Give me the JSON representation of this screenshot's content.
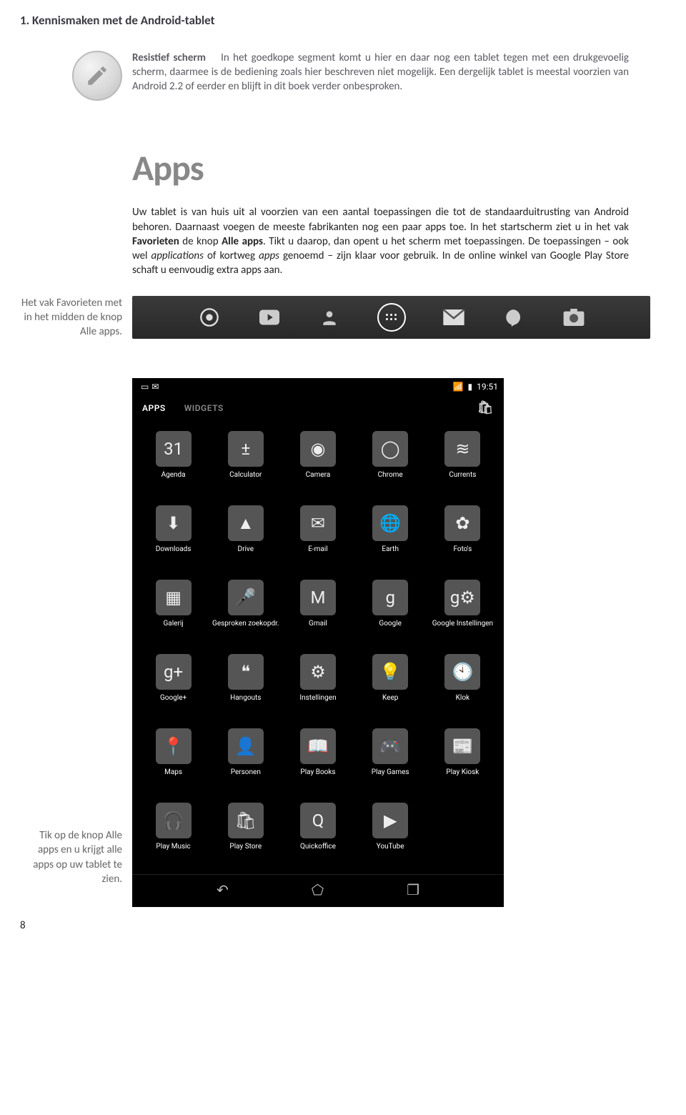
{
  "page": {
    "header": "1. Kennismaken met de Android-tablet",
    "number": "8"
  },
  "intro": {
    "lead": "Resistief scherm",
    "text": "In het goedkope segment komt u hier en daar nog een tablet tegen met een drukgevoelig scherm, daarmee is de bediening zoals hier beschreven niet mogelijk. Een dergelijk tablet is meestal voorzien van Android 2.2 of eerder en blijft in dit boek verder onbesproken."
  },
  "apps_section": {
    "title": "Apps",
    "body_prefix": "Uw tablet is van huis uit al voorzien van een aantal toepassingen die tot de standaarduitrusting van Android behoren. Daarnaast voegen de meeste fabrikanten nog een paar apps toe. In het startscherm ziet u in het vak ",
    "bold1": "Favorieten",
    "body_mid1": " de knop ",
    "bold2": "Alle apps",
    "body_mid2": ". Tikt u daarop, dan opent u het scherm met toepassingen. De toepassingen – ook wel ",
    "italic": "applications",
    "body_mid3": " of kortweg ",
    "italic2": "apps",
    "body_suffix": " genoemd – zijn klaar voor gebruik. In de online winkel van Google Play Store schaft u eenvoudig extra apps aan."
  },
  "caption1": "Het vak Favorieten met in het midden de knop Alle apps.",
  "caption2": "Tik op de knop Alle apps en u krijgt alle apps op uw tablet te zien.",
  "favbar": {
    "icons": [
      "chrome-icon",
      "youtube-icon",
      "people-icon",
      "allapps-icon",
      "gmail-icon",
      "hangouts-icon",
      "camera-icon"
    ]
  },
  "phone": {
    "time": "19:51",
    "tabs": {
      "apps": "APPS",
      "widgets": "WIDGETS"
    },
    "apps": [
      {
        "label": "Agenda",
        "icon": "calendar-icon",
        "glyph": "31"
      },
      {
        "label": "Calculator",
        "icon": "calculator-icon",
        "glyph": "±"
      },
      {
        "label": "Camera",
        "icon": "camera-icon",
        "glyph": "◉"
      },
      {
        "label": "Chrome",
        "icon": "chrome-icon",
        "glyph": "◯"
      },
      {
        "label": "Currents",
        "icon": "currents-icon",
        "glyph": "≋"
      },
      {
        "label": "Downloads",
        "icon": "downloads-icon",
        "glyph": "⬇"
      },
      {
        "label": "Drive",
        "icon": "drive-icon",
        "glyph": "▲"
      },
      {
        "label": "E-mail",
        "icon": "email-icon",
        "glyph": "✉"
      },
      {
        "label": "Earth",
        "icon": "earth-icon",
        "glyph": "🌐"
      },
      {
        "label": "Foto's",
        "icon": "photos-icon",
        "glyph": "✿"
      },
      {
        "label": "Galerij",
        "icon": "gallery-icon",
        "glyph": "▦"
      },
      {
        "label": "Gesproken zoekopdr.",
        "icon": "voice-icon",
        "glyph": "🎤"
      },
      {
        "label": "Gmail",
        "icon": "gmail-icon",
        "glyph": "M"
      },
      {
        "label": "Google",
        "icon": "google-icon",
        "glyph": "g"
      },
      {
        "label": "Google Instellingen",
        "icon": "gsettings-icon",
        "glyph": "g⚙"
      },
      {
        "label": "Google+",
        "icon": "gplus-icon",
        "glyph": "g+"
      },
      {
        "label": "Hangouts",
        "icon": "hangouts-icon",
        "glyph": "❝"
      },
      {
        "label": "Instellingen",
        "icon": "settings-icon",
        "glyph": "⚙"
      },
      {
        "label": "Keep",
        "icon": "keep-icon",
        "glyph": "💡"
      },
      {
        "label": "Klok",
        "icon": "clock-icon",
        "glyph": "🕙"
      },
      {
        "label": "Maps",
        "icon": "maps-icon",
        "glyph": "📍"
      },
      {
        "label": "Personen",
        "icon": "people-icon",
        "glyph": "👤"
      },
      {
        "label": "Play Books",
        "icon": "playbooks-icon",
        "glyph": "📖"
      },
      {
        "label": "Play Games",
        "icon": "playgames-icon",
        "glyph": "🎮"
      },
      {
        "label": "Play Kiosk",
        "icon": "playkiosk-icon",
        "glyph": "📰"
      },
      {
        "label": "Play Music",
        "icon": "playmusic-icon",
        "glyph": "🎧"
      },
      {
        "label": "Play Store",
        "icon": "playstore-icon",
        "glyph": "🛍"
      },
      {
        "label": "Quickoffice",
        "icon": "quickoffice-icon",
        "glyph": "Q"
      },
      {
        "label": "YouTube",
        "icon": "youtube-icon",
        "glyph": "▶"
      }
    ],
    "nav": [
      "back-icon",
      "home-icon",
      "recent-icon"
    ]
  }
}
